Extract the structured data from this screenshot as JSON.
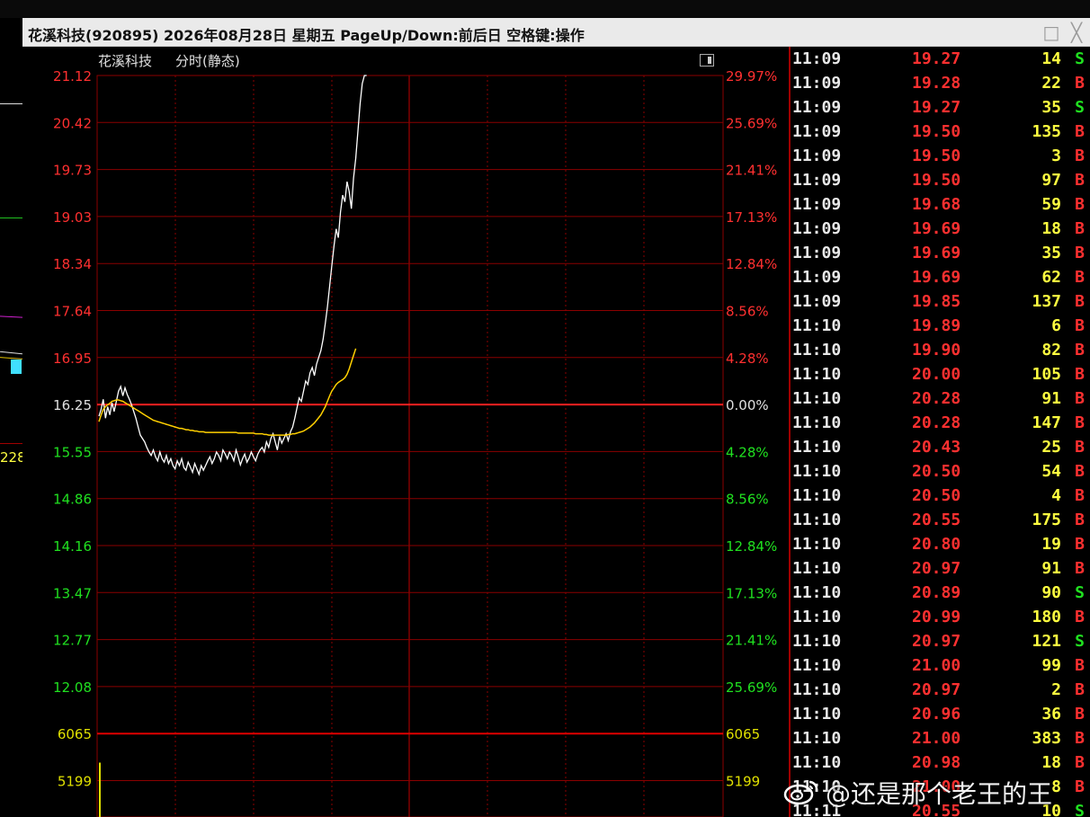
{
  "window": {
    "title": "花溪科技(920895) 2026年08月28日 星期五 PageUp/Down:前后日 空格键:操作",
    "restore_icon": "□",
    "close_icon": "╳"
  },
  "chart": {
    "stock_name": "花溪科技",
    "mode_label": "分时(静态)",
    "colors": {
      "grid": "#8b0000",
      "center_line": "#ff2020",
      "price_line": "#ffffff",
      "avg_line": "#ffd000",
      "up_text": "#ff3030",
      "down_text": "#20e020",
      "flat_text": "#e0e0e0",
      "volume_text": "#e0e000"
    },
    "price_labels": [
      "21.12",
      "20.42",
      "19.73",
      "19.03",
      "18.34",
      "17.64",
      "16.95",
      "16.25",
      "15.55",
      "14.86",
      "14.16",
      "13.47",
      "12.77",
      "12.08"
    ],
    "pct_labels": [
      "29.97%",
      "25.69%",
      "21.41%",
      "17.13%",
      "12.84%",
      "8.56%",
      "4.28%",
      "0.00%",
      "4.28%",
      "8.56%",
      "12.84%",
      "17.13%",
      "21.41%",
      "25.69%"
    ],
    "volume_labels": [
      "6065",
      "5199"
    ],
    "chart_data": {
      "type": "line",
      "prev_close": 16.25,
      "ylim": [
        12.08,
        21.12
      ],
      "x_unit": "minute index from open",
      "xlim": [
        0,
        240
      ],
      "series": [
        {
          "name": "price",
          "x": [
            0,
            1,
            2,
            3,
            4,
            5,
            6,
            7,
            8,
            9,
            10,
            11,
            12,
            13,
            14,
            15,
            16,
            17,
            18,
            19,
            20,
            21,
            22,
            23,
            24,
            25,
            26,
            27,
            28,
            29,
            30,
            31,
            32,
            33,
            34,
            35,
            36,
            37,
            38,
            39,
            40,
            41,
            42,
            43,
            44,
            45,
            46,
            47,
            48,
            49,
            50,
            51,
            52,
            53,
            54,
            55,
            56,
            57,
            58,
            59,
            60,
            61,
            62,
            63,
            64,
            65,
            66,
            67,
            68,
            69,
            70,
            71,
            72,
            73,
            74,
            75,
            76,
            77,
            78,
            79,
            80,
            81,
            82,
            83,
            84,
            85,
            86,
            87,
            88,
            89,
            90,
            91,
            92,
            93,
            94,
            95,
            96,
            97,
            98,
            99,
            100,
            101,
            102,
            103,
            104,
            105,
            106,
            107,
            108,
            109,
            110,
            111,
            112,
            113,
            114,
            115,
            116,
            117,
            118,
            119,
            120,
            121,
            122,
            123,
            124,
            125,
            126,
            127,
            128,
            129,
            130,
            131,
            132,
            133,
            134,
            135,
            136,
            137,
            138,
            139,
            140,
            141,
            142,
            143,
            144,
            145,
            146,
            147,
            148,
            149,
            150,
            151,
            152,
            153,
            154,
            155,
            156,
            157,
            158,
            159,
            160,
            161,
            162,
            163,
            164,
            165,
            166,
            167,
            168,
            169,
            170,
            171,
            172,
            173,
            174,
            175,
            176,
            177,
            178,
            179,
            180,
            181,
            182,
            183,
            184,
            185,
            186,
            187,
            188,
            189,
            190,
            191,
            192,
            193,
            194,
            195,
            196,
            197,
            198,
            199,
            200,
            201,
            202,
            203,
            204,
            205,
            206,
            207,
            208,
            209,
            210,
            211,
            212,
            213,
            214,
            215,
            216,
            217,
            218,
            219,
            220,
            221,
            222,
            223,
            224,
            225,
            226,
            227,
            228,
            229,
            230,
            231,
            232,
            233,
            234,
            235,
            236,
            237,
            238,
            239,
            240
          ],
          "y": [
            16.08,
            16.18,
            16.33,
            16.05,
            16.22,
            16.1,
            16.28,
            16.15,
            16.3,
            16.45,
            16.52,
            16.38,
            16.5,
            16.4,
            16.33,
            16.25,
            16.15,
            16.05,
            15.92,
            15.8,
            15.75,
            15.7,
            15.62,
            15.55,
            15.5,
            15.58,
            15.48,
            15.42,
            15.55,
            15.45,
            15.4,
            15.5,
            15.38,
            15.45,
            15.35,
            15.3,
            15.42,
            15.35,
            15.45,
            15.32,
            15.28,
            15.4,
            15.33,
            15.25,
            15.38,
            15.3,
            15.22,
            15.35,
            15.28,
            15.35,
            15.42,
            15.48,
            15.38,
            15.45,
            15.55,
            15.5,
            15.42,
            15.58,
            15.52,
            15.45,
            15.55,
            15.5,
            15.42,
            15.58,
            15.48,
            15.36,
            15.45,
            15.52,
            15.4,
            15.46,
            15.55,
            15.48,
            15.42,
            15.52,
            15.58,
            15.62,
            15.55,
            15.7,
            15.62,
            15.75,
            15.82,
            15.7,
            15.58,
            15.78,
            15.68,
            15.75,
            15.82,
            15.72,
            15.85,
            15.92,
            16.05,
            16.2,
            16.35,
            16.3,
            16.45,
            16.6,
            16.55,
            16.72,
            16.8,
            16.68,
            16.85,
            16.95,
            17.05,
            17.22,
            17.45,
            17.7,
            18.0,
            18.3,
            18.6,
            18.85,
            18.72,
            19.1,
            19.35,
            19.25,
            19.55,
            19.4,
            19.15,
            19.6,
            19.9,
            20.3,
            20.7,
            21.0,
            21.12,
            21.12
          ],
          "note": ""
        },
        {
          "name": "avg",
          "y": [
            16.0,
            16.1,
            16.18,
            16.22,
            16.25,
            16.27,
            16.3,
            16.31,
            16.32,
            16.32,
            16.31,
            16.3,
            16.28,
            16.26,
            16.24,
            16.22,
            16.2,
            16.18,
            16.16,
            16.14,
            16.12,
            16.1,
            16.08,
            16.06,
            16.04,
            16.02,
            16.01,
            16.0,
            15.99,
            15.98,
            15.97,
            15.96,
            15.95,
            15.94,
            15.93,
            15.92,
            15.91,
            15.9,
            15.9,
            15.89,
            15.88,
            15.88,
            15.87,
            15.87,
            15.86,
            15.86,
            15.85,
            15.85,
            15.85,
            15.84,
            15.84,
            15.84,
            15.84,
            15.84,
            15.84,
            15.84,
            15.84,
            15.84,
            15.84,
            15.84,
            15.84,
            15.84,
            15.84,
            15.84,
            15.83,
            15.83,
            15.83,
            15.83,
            15.83,
            15.83,
            15.83,
            15.83,
            15.82,
            15.82,
            15.82,
            15.82,
            15.81,
            15.81,
            15.8,
            15.8,
            15.8,
            15.8,
            15.8,
            15.8,
            15.8,
            15.8,
            15.8,
            15.81,
            15.81,
            15.82,
            15.82,
            15.83,
            15.84,
            15.85,
            15.86,
            15.88,
            15.9,
            15.92,
            15.95,
            15.98,
            16.02,
            16.06,
            16.1,
            16.16,
            16.22,
            16.3,
            16.38,
            16.45,
            16.5,
            16.55,
            16.58,
            16.6,
            16.62,
            16.65,
            16.7,
            16.78,
            16.88,
            16.98,
            17.08
          ]
        }
      ],
      "volume_ylim": [
        0,
        6065
      ]
    }
  },
  "ticks": {
    "rows": [
      {
        "time": "11:09",
        "price": "19.27",
        "vol": "14",
        "side": "S"
      },
      {
        "time": "11:09",
        "price": "19.28",
        "vol": "22",
        "side": "B"
      },
      {
        "time": "11:09",
        "price": "19.27",
        "vol": "35",
        "side": "S"
      },
      {
        "time": "11:09",
        "price": "19.50",
        "vol": "135",
        "side": "B"
      },
      {
        "time": "11:09",
        "price": "19.50",
        "vol": "3",
        "side": "B"
      },
      {
        "time": "11:09",
        "price": "19.50",
        "vol": "97",
        "side": "B"
      },
      {
        "time": "11:09",
        "price": "19.68",
        "vol": "59",
        "side": "B"
      },
      {
        "time": "11:09",
        "price": "19.69",
        "vol": "18",
        "side": "B"
      },
      {
        "time": "11:09",
        "price": "19.69",
        "vol": "35",
        "side": "B"
      },
      {
        "time": "11:09",
        "price": "19.69",
        "vol": "62",
        "side": "B"
      },
      {
        "time": "11:09",
        "price": "19.85",
        "vol": "137",
        "side": "B"
      },
      {
        "time": "11:10",
        "price": "19.89",
        "vol": "6",
        "side": "B"
      },
      {
        "time": "11:10",
        "price": "19.90",
        "vol": "82",
        "side": "B"
      },
      {
        "time": "11:10",
        "price": "20.00",
        "vol": "105",
        "side": "B"
      },
      {
        "time": "11:10",
        "price": "20.28",
        "vol": "91",
        "side": "B"
      },
      {
        "time": "11:10",
        "price": "20.28",
        "vol": "147",
        "side": "B"
      },
      {
        "time": "11:10",
        "price": "20.43",
        "vol": "25",
        "side": "B"
      },
      {
        "time": "11:10",
        "price": "20.50",
        "vol": "54",
        "side": "B"
      },
      {
        "time": "11:10",
        "price": "20.50",
        "vol": "4",
        "side": "B"
      },
      {
        "time": "11:10",
        "price": "20.55",
        "vol": "175",
        "side": "B"
      },
      {
        "time": "11:10",
        "price": "20.80",
        "vol": "19",
        "side": "B"
      },
      {
        "time": "11:10",
        "price": "20.97",
        "vol": "91",
        "side": "B"
      },
      {
        "time": "11:10",
        "price": "20.89",
        "vol": "90",
        "side": "S"
      },
      {
        "time": "11:10",
        "price": "20.99",
        "vol": "180",
        "side": "B"
      },
      {
        "time": "11:10",
        "price": "20.97",
        "vol": "121",
        "side": "S"
      },
      {
        "time": "11:10",
        "price": "21.00",
        "vol": "99",
        "side": "B"
      },
      {
        "time": "11:10",
        "price": "20.97",
        "vol": "2",
        "side": "B"
      },
      {
        "time": "11:10",
        "price": "20.96",
        "vol": "36",
        "side": "B"
      },
      {
        "time": "11:10",
        "price": "21.00",
        "vol": "383",
        "side": "B"
      },
      {
        "time": "11:10",
        "price": "20.98",
        "vol": "18",
        "side": "B"
      },
      {
        "time": "11:10",
        "price": "21.00",
        "vol": "8",
        "side": "B"
      },
      {
        "time": "11:11",
        "price": "20.55",
        "vol": "10",
        "side": "S"
      }
    ],
    "side_colors": {
      "B": "#ff3030",
      "S": "#20e020"
    }
  },
  "left_panel": {
    "partial_label": "228"
  },
  "watermark": {
    "text": "@还是那个老王的王",
    "logo_icon": "weibo-logo"
  }
}
